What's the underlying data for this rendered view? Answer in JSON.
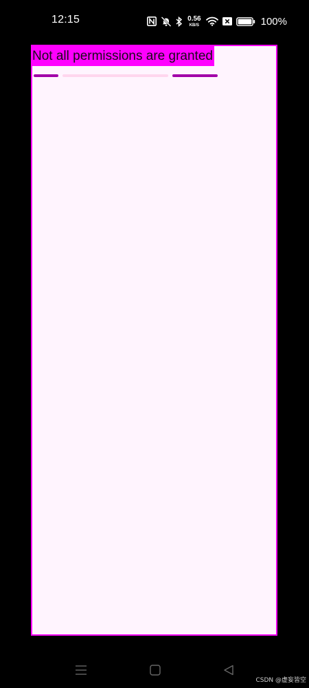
{
  "status_bar": {
    "time": "12:15",
    "network_speed_value": "0.56",
    "network_speed_unit": "KB/S",
    "battery_percent": "100%",
    "icons": [
      "nfc-icon",
      "mute-icon",
      "bluetooth-icon",
      "wifi-icon",
      "sim-x-icon",
      "battery-icon"
    ]
  },
  "app": {
    "message": "Not all permissions are granted",
    "progress_segments": [
      "active",
      "inactive",
      "active"
    ]
  },
  "nav_bar": {
    "buttons": [
      "menu",
      "home",
      "back"
    ]
  },
  "watermark": "CSDN @虚妄皆空",
  "colors": {
    "frame_border": "#ff00ff",
    "message_bg": "#ff00ff",
    "app_bg": "#fff4fe",
    "segment_active": "#a200a8",
    "segment_inactive": "#ffd6ee"
  }
}
